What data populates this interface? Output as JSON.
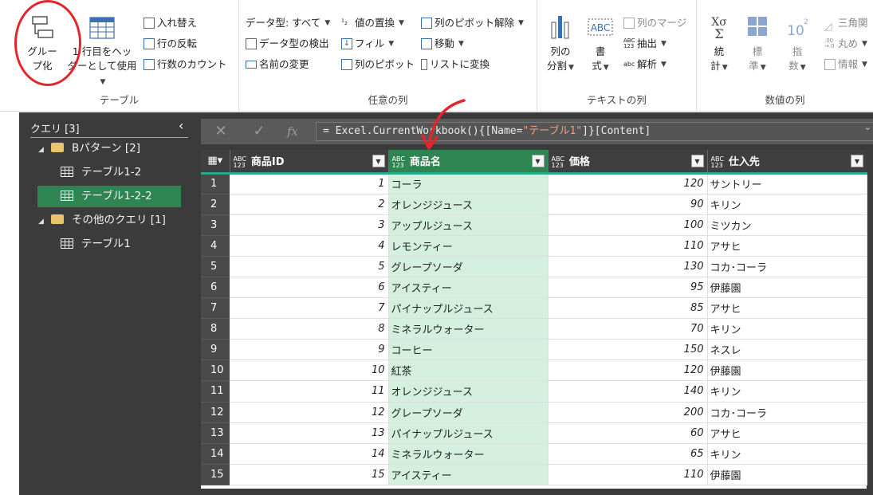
{
  "ribbon": {
    "table_group": {
      "label": "テーブル",
      "group_by_line1": "グルー",
      "group_by_line2": "プ化",
      "use_first_row_line1": "1 行目をヘッ",
      "use_first_row_line2": "ダーとして使用",
      "transpose": "入れ替え",
      "reverse_rows": "行の反転",
      "count_rows": "行数のカウント"
    },
    "any_column_group": {
      "label": "任意の列",
      "data_type": "データ型: すべて",
      "detect_type": "データ型の検出",
      "rename": "名前の変更",
      "replace_values": "値の置換",
      "fill": "フィル",
      "pivot_column": "列のピボット",
      "unpivot": "列のピボット解除",
      "move": "移動",
      "convert_to_list": "リストに変換"
    },
    "text_column_group": {
      "label": "テキストの列",
      "split_line1": "列の",
      "split_line2": "分割",
      "format_line1": "書",
      "format_line2": "式",
      "merge_columns": "列のマージ",
      "extract": "抽出",
      "parse": "解析"
    },
    "number_column_group": {
      "label": "数値の列",
      "stats_line1": "統",
      "stats_line2": "計",
      "standard_line1": "標",
      "standard_line2": "準",
      "scientific_line1": "指",
      "scientific_line2": "数",
      "trig": "三角関",
      "round": "丸め",
      "info": "情報"
    }
  },
  "queries": {
    "header": "クエリ [3]",
    "items": [
      {
        "label": "Bパターン [2]",
        "kind": "folder"
      },
      {
        "label": "テーブル1-2",
        "kind": "table"
      },
      {
        "label": "テーブル1-2-2",
        "kind": "table",
        "selected": true
      },
      {
        "label": "その他のクエリ [1]",
        "kind": "folder"
      },
      {
        "label": "テーブル1",
        "kind": "table"
      }
    ]
  },
  "formula_bar": {
    "prefix": "= Excel.CurrentWorkbook(){[Name=",
    "string": "\"テーブル1\"",
    "suffix": "]}[Content]"
  },
  "grid": {
    "type_label_top": "ABC",
    "type_label_bottom": "123",
    "columns": [
      "商品ID",
      "商品名",
      "価格",
      "仕入先"
    ],
    "rows": [
      [
        1,
        "コーラ",
        120,
        "サントリー"
      ],
      [
        2,
        "オレンジジュース",
        90,
        "キリン"
      ],
      [
        3,
        "アップルジュース",
        100,
        "ミツカン"
      ],
      [
        4,
        "レモンティー",
        110,
        "アサヒ"
      ],
      [
        5,
        "グレープソーダ",
        130,
        "コカ･コーラ"
      ],
      [
        6,
        "アイスティー",
        95,
        "伊藤園"
      ],
      [
        7,
        "パイナップルジュース",
        85,
        "アサヒ"
      ],
      [
        8,
        "ミネラルウォーター",
        70,
        "キリン"
      ],
      [
        9,
        "コーヒー",
        150,
        "ネスレ"
      ],
      [
        10,
        "紅茶",
        120,
        "伊藤園"
      ],
      [
        11,
        "オレンジジュース",
        140,
        "キリン"
      ],
      [
        12,
        "グレープソーダ",
        200,
        "コカ･コーラ"
      ],
      [
        13,
        "パイナップルジュース",
        60,
        "アサヒ"
      ],
      [
        14,
        "ミネラルウォーター",
        65,
        "キリン"
      ],
      [
        15,
        "アイスティー",
        110,
        "伊藤園"
      ]
    ]
  },
  "colors": {
    "selected_green": "#2f8552",
    "selected_column_fill": "#d4eedf",
    "annotation_red": "#e3262b"
  }
}
